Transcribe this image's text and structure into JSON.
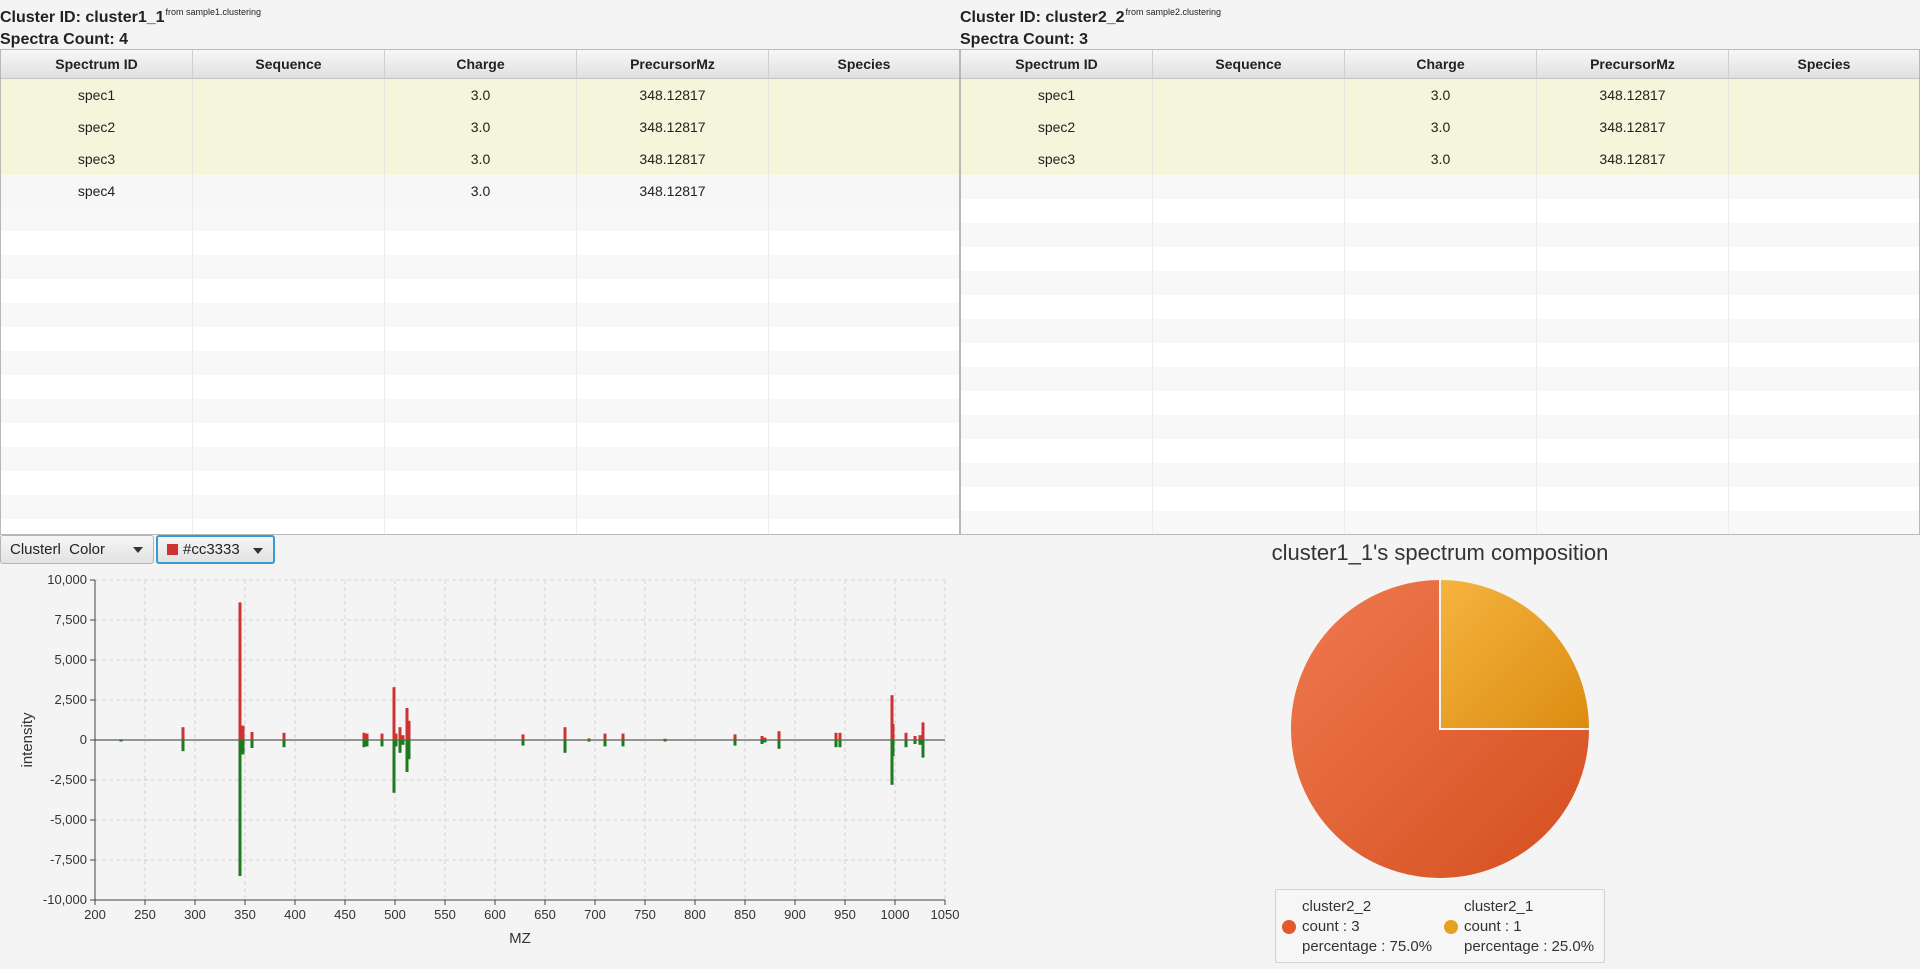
{
  "left": {
    "cluster_label": "Cluster ID: cluster1_1",
    "source": "from sample1.clustering",
    "spectra_count": "Spectra Count: 4",
    "columns": [
      "Spectrum ID",
      "Sequence",
      "Charge",
      "PrecursorMz",
      "Species"
    ],
    "rows": [
      {
        "spectrum_id": "spec1",
        "sequence": "",
        "charge": "3.0",
        "precursor_mz": "348.12817",
        "species": "",
        "highlighted": true
      },
      {
        "spectrum_id": "spec2",
        "sequence": "",
        "charge": "3.0",
        "precursor_mz": "348.12817",
        "species": "",
        "highlighted": true
      },
      {
        "spectrum_id": "spec3",
        "sequence": "",
        "charge": "3.0",
        "precursor_mz": "348.12817",
        "species": "",
        "highlighted": true
      },
      {
        "spectrum_id": "spec4",
        "sequence": "",
        "charge": "3.0",
        "precursor_mz": "348.12817",
        "species": "",
        "highlighted": false
      }
    ]
  },
  "right": {
    "cluster_label": "Cluster ID: cluster2_2",
    "source": "from sample2.clustering",
    "spectra_count": "Spectra Count: 3",
    "columns": [
      "Spectrum ID",
      "Sequence",
      "Charge",
      "PrecursorMz",
      "Species"
    ],
    "rows": [
      {
        "spectrum_id": "spec1",
        "sequence": "",
        "charge": "3.0",
        "precursor_mz": "348.12817",
        "species": "",
        "highlighted": true
      },
      {
        "spectrum_id": "spec2",
        "sequence": "",
        "charge": "3.0",
        "precursor_mz": "348.12817",
        "species": "",
        "highlighted": true
      },
      {
        "spectrum_id": "spec3",
        "sequence": "",
        "charge": "3.0",
        "precursor_mz": "348.12817",
        "species": "",
        "highlighted": true
      }
    ]
  },
  "controls": {
    "cluster_combo": "Clusterl  Color",
    "color_combo": "#cc3333",
    "color_value": "#cc3333"
  },
  "chart_data": [
    {
      "type": "bar",
      "title": "",
      "xlabel": "MZ",
      "ylabel": "intensity",
      "xlim": [
        200,
        1050
      ],
      "ylim": [
        -10000,
        10000
      ],
      "xticks": [
        "200",
        "250",
        "300",
        "350",
        "400",
        "450",
        "500",
        "550",
        "600",
        "650",
        "700",
        "750",
        "800",
        "850",
        "900",
        "950",
        "1000",
        "1050"
      ],
      "yticks": [
        "10,000",
        "7,500",
        "5,000",
        "2,500",
        "0",
        "-2,500",
        "-5,000",
        "-7,500",
        "-10,000"
      ],
      "grid": true,
      "series": [
        {
          "color": "#cc3333",
          "mz": [
            226,
            288,
            345,
            348,
            357,
            389,
            469,
            472,
            487,
            499,
            501,
            505,
            508,
            512,
            514,
            628,
            670,
            694,
            710,
            728,
            770,
            840,
            867,
            870,
            884,
            941,
            945,
            997,
            998,
            1011,
            1020,
            1025,
            1028
          ],
          "values": [
            50,
            800,
            8600,
            900,
            500,
            450,
            450,
            400,
            400,
            3300,
            400,
            800,
            300,
            2000,
            1200,
            350,
            800,
            100,
            400,
            400,
            80,
            350,
            250,
            150,
            550,
            450,
            450,
            2800,
            1000,
            450,
            250,
            300,
            1100
          ]
        },
        {
          "color": "#1f7a1f",
          "mz": [
            226,
            288,
            345,
            348,
            357,
            389,
            469,
            472,
            487,
            499,
            501,
            505,
            508,
            512,
            514,
            628,
            670,
            694,
            710,
            728,
            770,
            840,
            867,
            870,
            884,
            941,
            945,
            997,
            998,
            1011,
            1020,
            1025,
            1028
          ],
          "values": [
            -50,
            -700,
            -8500,
            -900,
            -500,
            -450,
            -450,
            -400,
            -400,
            -3300,
            -400,
            -800,
            -300,
            -2000,
            -1200,
            -350,
            -800,
            -100,
            -400,
            -400,
            -80,
            -350,
            -250,
            -150,
            -550,
            -450,
            -450,
            -2800,
            -1000,
            -450,
            -250,
            -300,
            -1100
          ]
        }
      ]
    },
    {
      "type": "pie",
      "title": "cluster1_1's spectrum composition",
      "slices": [
        {
          "name": "cluster2_2",
          "value": 3,
          "percentage": 75.0,
          "count_label": "count : 3",
          "pct_label": "percentage : 75.0%",
          "color": "#e05a2a"
        },
        {
          "name": "cluster2_1",
          "value": 1,
          "percentage": 25.0,
          "count_label": "count : 1",
          "pct_label": "percentage : 25.0%",
          "color": "#e8a020"
        }
      ],
      "legend": "bottom"
    }
  ]
}
